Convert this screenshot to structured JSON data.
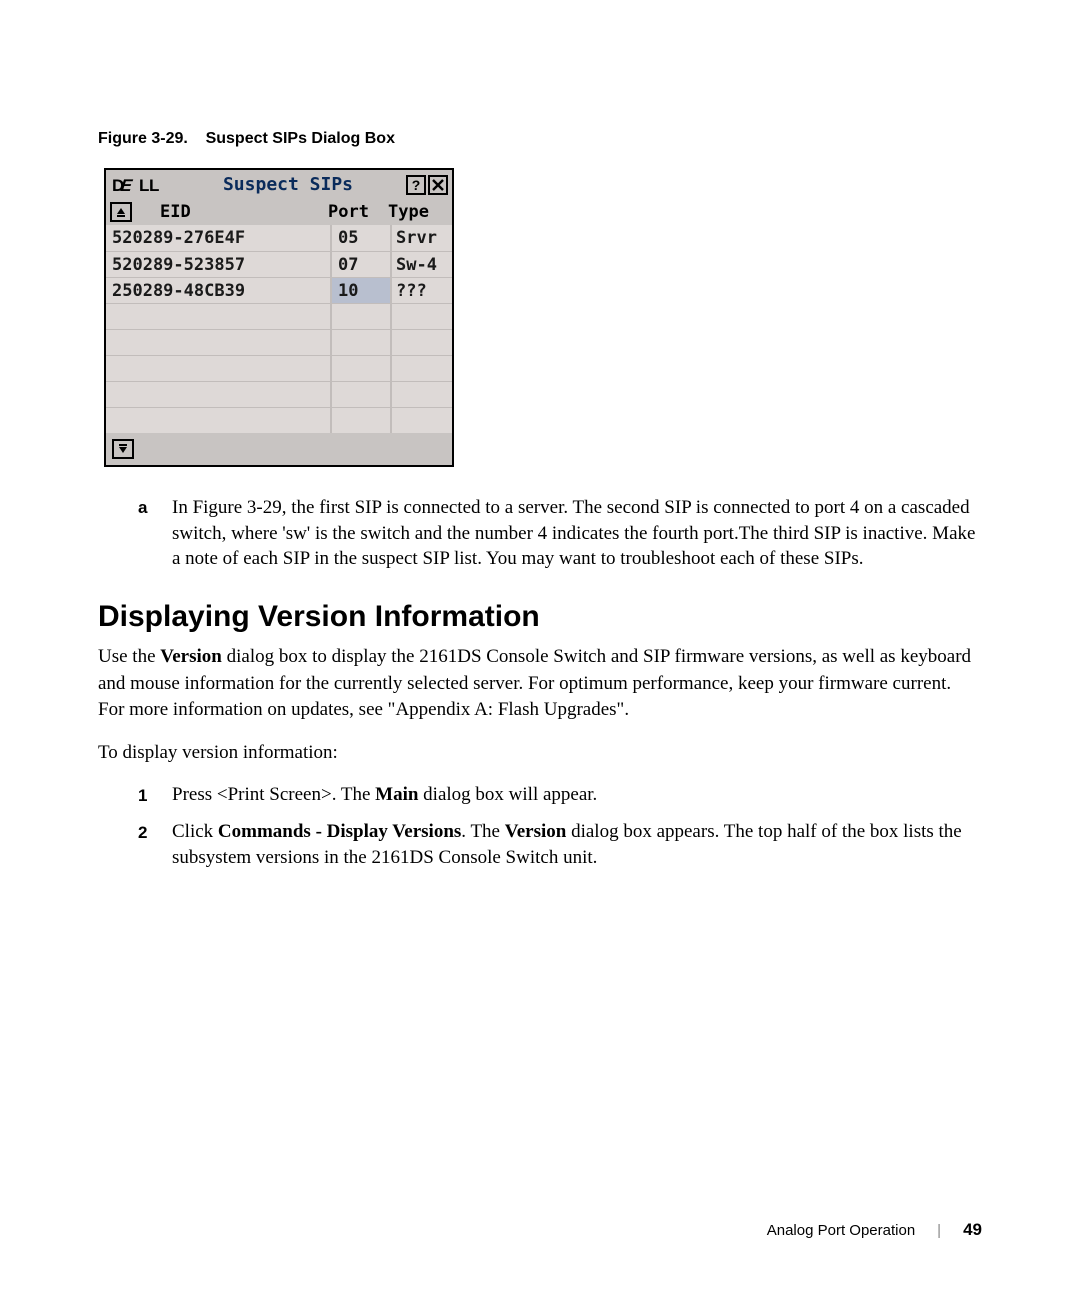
{
  "figure_caption": "Figure 3-29.    Suspect SIPs Dialog Box",
  "dialog": {
    "brand": "DELL",
    "title": "Suspect SIPs",
    "help_label": "?",
    "close_label": "✕",
    "headers": {
      "eid": "EID",
      "port": "Port",
      "type": "Type"
    },
    "rows": [
      {
        "eid": "520289-276E4F",
        "port": "05",
        "type": "Srvr",
        "selected": false
      },
      {
        "eid": "520289-523857",
        "port": "07",
        "type": "Sw-4",
        "selected": false
      },
      {
        "eid": "250289-48CB39",
        "port": "10",
        "type": "???",
        "selected": true
      },
      {
        "eid": "",
        "port": "",
        "type": "",
        "selected": false
      },
      {
        "eid": "",
        "port": "",
        "type": "",
        "selected": false
      },
      {
        "eid": "",
        "port": "",
        "type": "",
        "selected": false
      },
      {
        "eid": "",
        "port": "",
        "type": "",
        "selected": false
      },
      {
        "eid": "",
        "port": "",
        "type": "",
        "selected": false
      }
    ]
  },
  "annotation": {
    "label": "a",
    "text": "In Figure 3-29, the first SIP is connected to a server. The second SIP is connected to port 4 on a cascaded switch, where 'sw' is the switch and the number 4 indicates the fourth port.The third SIP is inactive. Make a note of each SIP in the suspect SIP list. You may want to troubleshoot each of these SIPs."
  },
  "section_heading": "Displaying Version Information",
  "para1_pre": "Use the ",
  "para1_bold": "Version",
  "para1_post": " dialog box to display the 2161DS Console Switch and SIP firmware versions, as well as keyboard and mouse information for the currently selected server. For optimum performance, keep your firmware current. For more information on updates, see \"Appendix A: Flash Upgrades\".",
  "para2": "To display version information:",
  "step1_pre": "Press <Print Screen>. The ",
  "step1_bold": "Main",
  "step1_post": " dialog box will appear.",
  "step2_pre": "Click ",
  "step2_bold1": "Commands - Display Versions",
  "step2_mid": ". The ",
  "step2_bold2": "Version",
  "step2_post": " dialog box appears. The top half of the box lists the subsystem versions in the 2161DS Console Switch unit.",
  "footer": {
    "section": "Analog Port Operation",
    "page": "49"
  }
}
